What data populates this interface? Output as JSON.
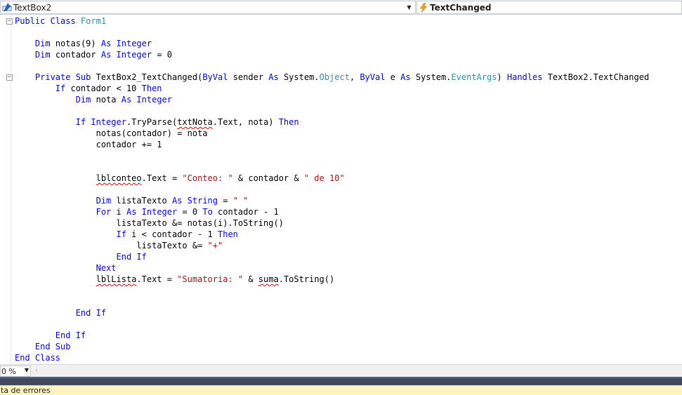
{
  "navbar": {
    "left_combo": {
      "text": "TextBox2",
      "icon": "textbox-control-icon"
    },
    "right_combo": {
      "text": "TextChanged",
      "icon": "lightning-event-icon"
    }
  },
  "code": {
    "lines": [
      [
        {
          "c": "kw",
          "t": "Public Class "
        },
        {
          "c": "ty",
          "t": "Form1"
        }
      ],
      [],
      [
        {
          "t": "    "
        },
        {
          "c": "kw",
          "t": "Dim"
        },
        {
          "t": " notas(9) "
        },
        {
          "c": "kw",
          "t": "As Integer"
        }
      ],
      [
        {
          "t": "    "
        },
        {
          "c": "kw",
          "t": "Dim"
        },
        {
          "t": " contador "
        },
        {
          "c": "kw",
          "t": "As Integer"
        },
        {
          "t": " = 0"
        }
      ],
      [],
      [
        {
          "t": "    "
        },
        {
          "c": "kw",
          "t": "Private Sub"
        },
        {
          "t": " TextBox2_TextChanged("
        },
        {
          "c": "kw",
          "t": "ByVal"
        },
        {
          "t": " sender "
        },
        {
          "c": "kw",
          "t": "As"
        },
        {
          "t": " System."
        },
        {
          "c": "ty",
          "t": "Object"
        },
        {
          "t": ", "
        },
        {
          "c": "kw",
          "t": "ByVal"
        },
        {
          "t": " e "
        },
        {
          "c": "kw",
          "t": "As"
        },
        {
          "t": " System."
        },
        {
          "c": "ty",
          "t": "EventArgs"
        },
        {
          "t": ") "
        },
        {
          "c": "kw",
          "t": "Handles"
        },
        {
          "t": " TextBox2.TextChanged"
        }
      ],
      [
        {
          "t": "        "
        },
        {
          "c": "kw",
          "t": "If"
        },
        {
          "t": " contador < 10 "
        },
        {
          "c": "kw",
          "t": "Then"
        }
      ],
      [
        {
          "t": "            "
        },
        {
          "c": "kw",
          "t": "Dim"
        },
        {
          "t": " nota "
        },
        {
          "c": "kw",
          "t": "As Integer"
        }
      ],
      [],
      [
        {
          "t": "            "
        },
        {
          "c": "kw",
          "t": "If Integer"
        },
        {
          "t": ".TryParse("
        },
        {
          "c": "sq",
          "t": "txtNota"
        },
        {
          "t": ".Text, nota) "
        },
        {
          "c": "kw",
          "t": "Then"
        }
      ],
      [
        {
          "t": "                notas(contador) = nota"
        }
      ],
      [
        {
          "t": "                contador += 1"
        }
      ],
      [],
      [],
      [
        {
          "t": "                "
        },
        {
          "c": "sq",
          "t": "lblconteo"
        },
        {
          "t": ".Text = "
        },
        {
          "c": "st",
          "t": "\"Conteo: \""
        },
        {
          "t": " & contador & "
        },
        {
          "c": "st",
          "t": "\" de 10\""
        }
      ],
      [],
      [
        {
          "t": "                "
        },
        {
          "c": "kw",
          "t": "Dim"
        },
        {
          "t": " listaTexto "
        },
        {
          "c": "kw",
          "t": "As String"
        },
        {
          "t": " = "
        },
        {
          "c": "st",
          "t": "\" \""
        }
      ],
      [
        {
          "t": "                "
        },
        {
          "c": "kw",
          "t": "For"
        },
        {
          "t": " i "
        },
        {
          "c": "kw",
          "t": "As Integer"
        },
        {
          "t": " = 0 "
        },
        {
          "c": "kw",
          "t": "To"
        },
        {
          "t": " contador - 1"
        }
      ],
      [
        {
          "t": "                    listaTexto &= notas(i).ToString()"
        }
      ],
      [
        {
          "t": "                    "
        },
        {
          "c": "kw",
          "t": "If"
        },
        {
          "t": " i < contador - 1 "
        },
        {
          "c": "kw",
          "t": "Then"
        }
      ],
      [
        {
          "t": "                        listaTexto &= "
        },
        {
          "c": "st",
          "t": "\"+\""
        }
      ],
      [
        {
          "t": "                    "
        },
        {
          "c": "kw",
          "t": "End If"
        }
      ],
      [
        {
          "t": "                "
        },
        {
          "c": "kw",
          "t": "Next"
        }
      ],
      [
        {
          "t": "                "
        },
        {
          "c": "sq",
          "t": "lblLista"
        },
        {
          "t": ".Text = "
        },
        {
          "c": "st",
          "t": "\"Sumatoria: \""
        },
        {
          "t": " & "
        },
        {
          "c": "sq",
          "t": "suma"
        },
        {
          "t": ".ToString()"
        }
      ],
      [],
      [],
      [
        {
          "t": "            "
        },
        {
          "c": "kw",
          "t": "End If"
        }
      ],
      [],
      [
        {
          "t": "        "
        },
        {
          "c": "kw",
          "t": "End If"
        }
      ],
      [
        {
          "t": "    "
        },
        {
          "c": "kw",
          "t": "End Sub"
        }
      ],
      [
        {
          "c": "kw",
          "t": "End Class"
        }
      ]
    ],
    "fold_markers": [
      {
        "line": 0,
        "symbol": "⊟"
      },
      {
        "line": 5,
        "symbol": "⊟"
      }
    ]
  },
  "bottom": {
    "zoom": "0 %",
    "scroll_left_glyph": "‹",
    "error_tab_label": "ta de errores"
  },
  "colors": {
    "keyword": "#0000ff",
    "type": "#2b91af",
    "string": "#a31515",
    "squiggle": "#e00000"
  }
}
